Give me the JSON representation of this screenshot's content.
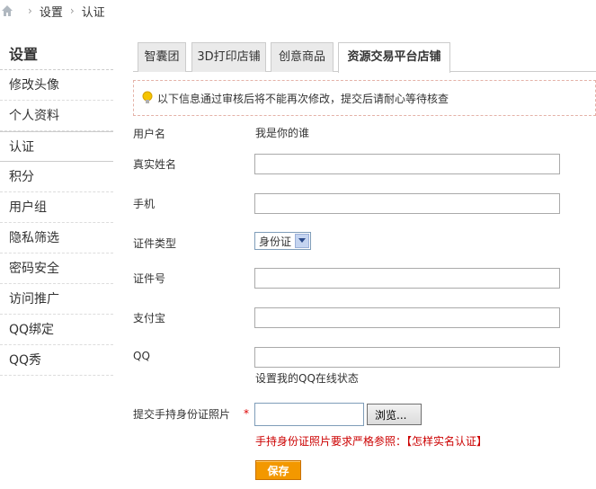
{
  "breadcrumb": {
    "items": [
      "设置",
      "认证"
    ]
  },
  "sidebar": {
    "title": "设置",
    "items": [
      {
        "label": "修改头像"
      },
      {
        "label": "个人资料"
      },
      {
        "label": "认证",
        "active": true
      },
      {
        "label": "积分"
      },
      {
        "label": "用户组"
      },
      {
        "label": "隐私筛选"
      },
      {
        "label": "密码安全"
      },
      {
        "label": "访问推广"
      },
      {
        "label": "QQ绑定"
      },
      {
        "label": "QQ秀"
      }
    ]
  },
  "tabs": [
    {
      "label": "智囊团"
    },
    {
      "label": "3D打印店铺"
    },
    {
      "label": "创意商品"
    },
    {
      "label": "资源交易平台店铺",
      "active": true
    }
  ],
  "notice": {
    "text": "以下信息通过审核后将不能再次修改，提交后请耐心等待核查"
  },
  "form": {
    "username_label": "用户名",
    "username_value": "我是你的谁",
    "realname_label": "真实姓名",
    "realname_value": "",
    "phone_label": "手机",
    "phone_value": "",
    "idtype_label": "证件类型",
    "idtype_value": "身份证",
    "idnum_label": "证件号",
    "idnum_value": "",
    "alipay_label": "支付宝",
    "alipay_value": "",
    "qq_label": "QQ",
    "qq_value": "",
    "qq_hint": "设置我的QQ在线状态",
    "photo_label": "提交手持身份证照片",
    "required_mark": "*",
    "browse_label": "浏览...",
    "photo_warn": "手持身份证照片要求严格参照：",
    "photo_warn_link": "【怎样实名认证】",
    "save_label": "保存"
  },
  "colors": {
    "accent": "#f39800",
    "warning": "#cc0000",
    "notice_border": "#e4b2a8"
  }
}
